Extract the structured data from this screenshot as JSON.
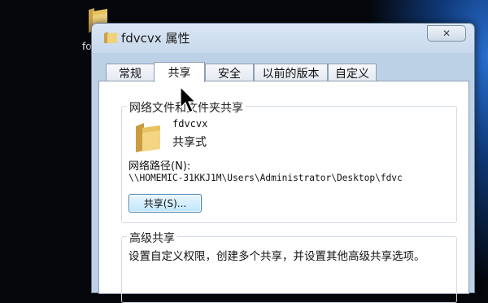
{
  "desktop": {
    "folder_label": "fo"
  },
  "window": {
    "title": "fdvcvx 属性",
    "close_glyph": "✕"
  },
  "tabs": [
    {
      "label": "常规"
    },
    {
      "label": "共享"
    },
    {
      "label": "安全"
    },
    {
      "label": "以前的版本"
    },
    {
      "label": "自定义"
    }
  ],
  "active_tab": "共享",
  "network_sharing": {
    "group_title": "网络文件和文件夹共享",
    "folder_name": "fdvcvx",
    "share_state": "共享式",
    "path_label": "网络路径(N):",
    "path_value": "\\\\HOMEMIC-31KKJ1M\\Users\\Administrator\\Desktop\\fdvc",
    "share_button_label": "共享(S)..."
  },
  "advanced_sharing": {
    "group_title": "高级共享",
    "description": "设置自定义权限，创建多个共享，并设置其他高级共享选项。"
  },
  "icons": {
    "folder": "folder-icon",
    "cursor": "mouse-pointer-icon"
  }
}
